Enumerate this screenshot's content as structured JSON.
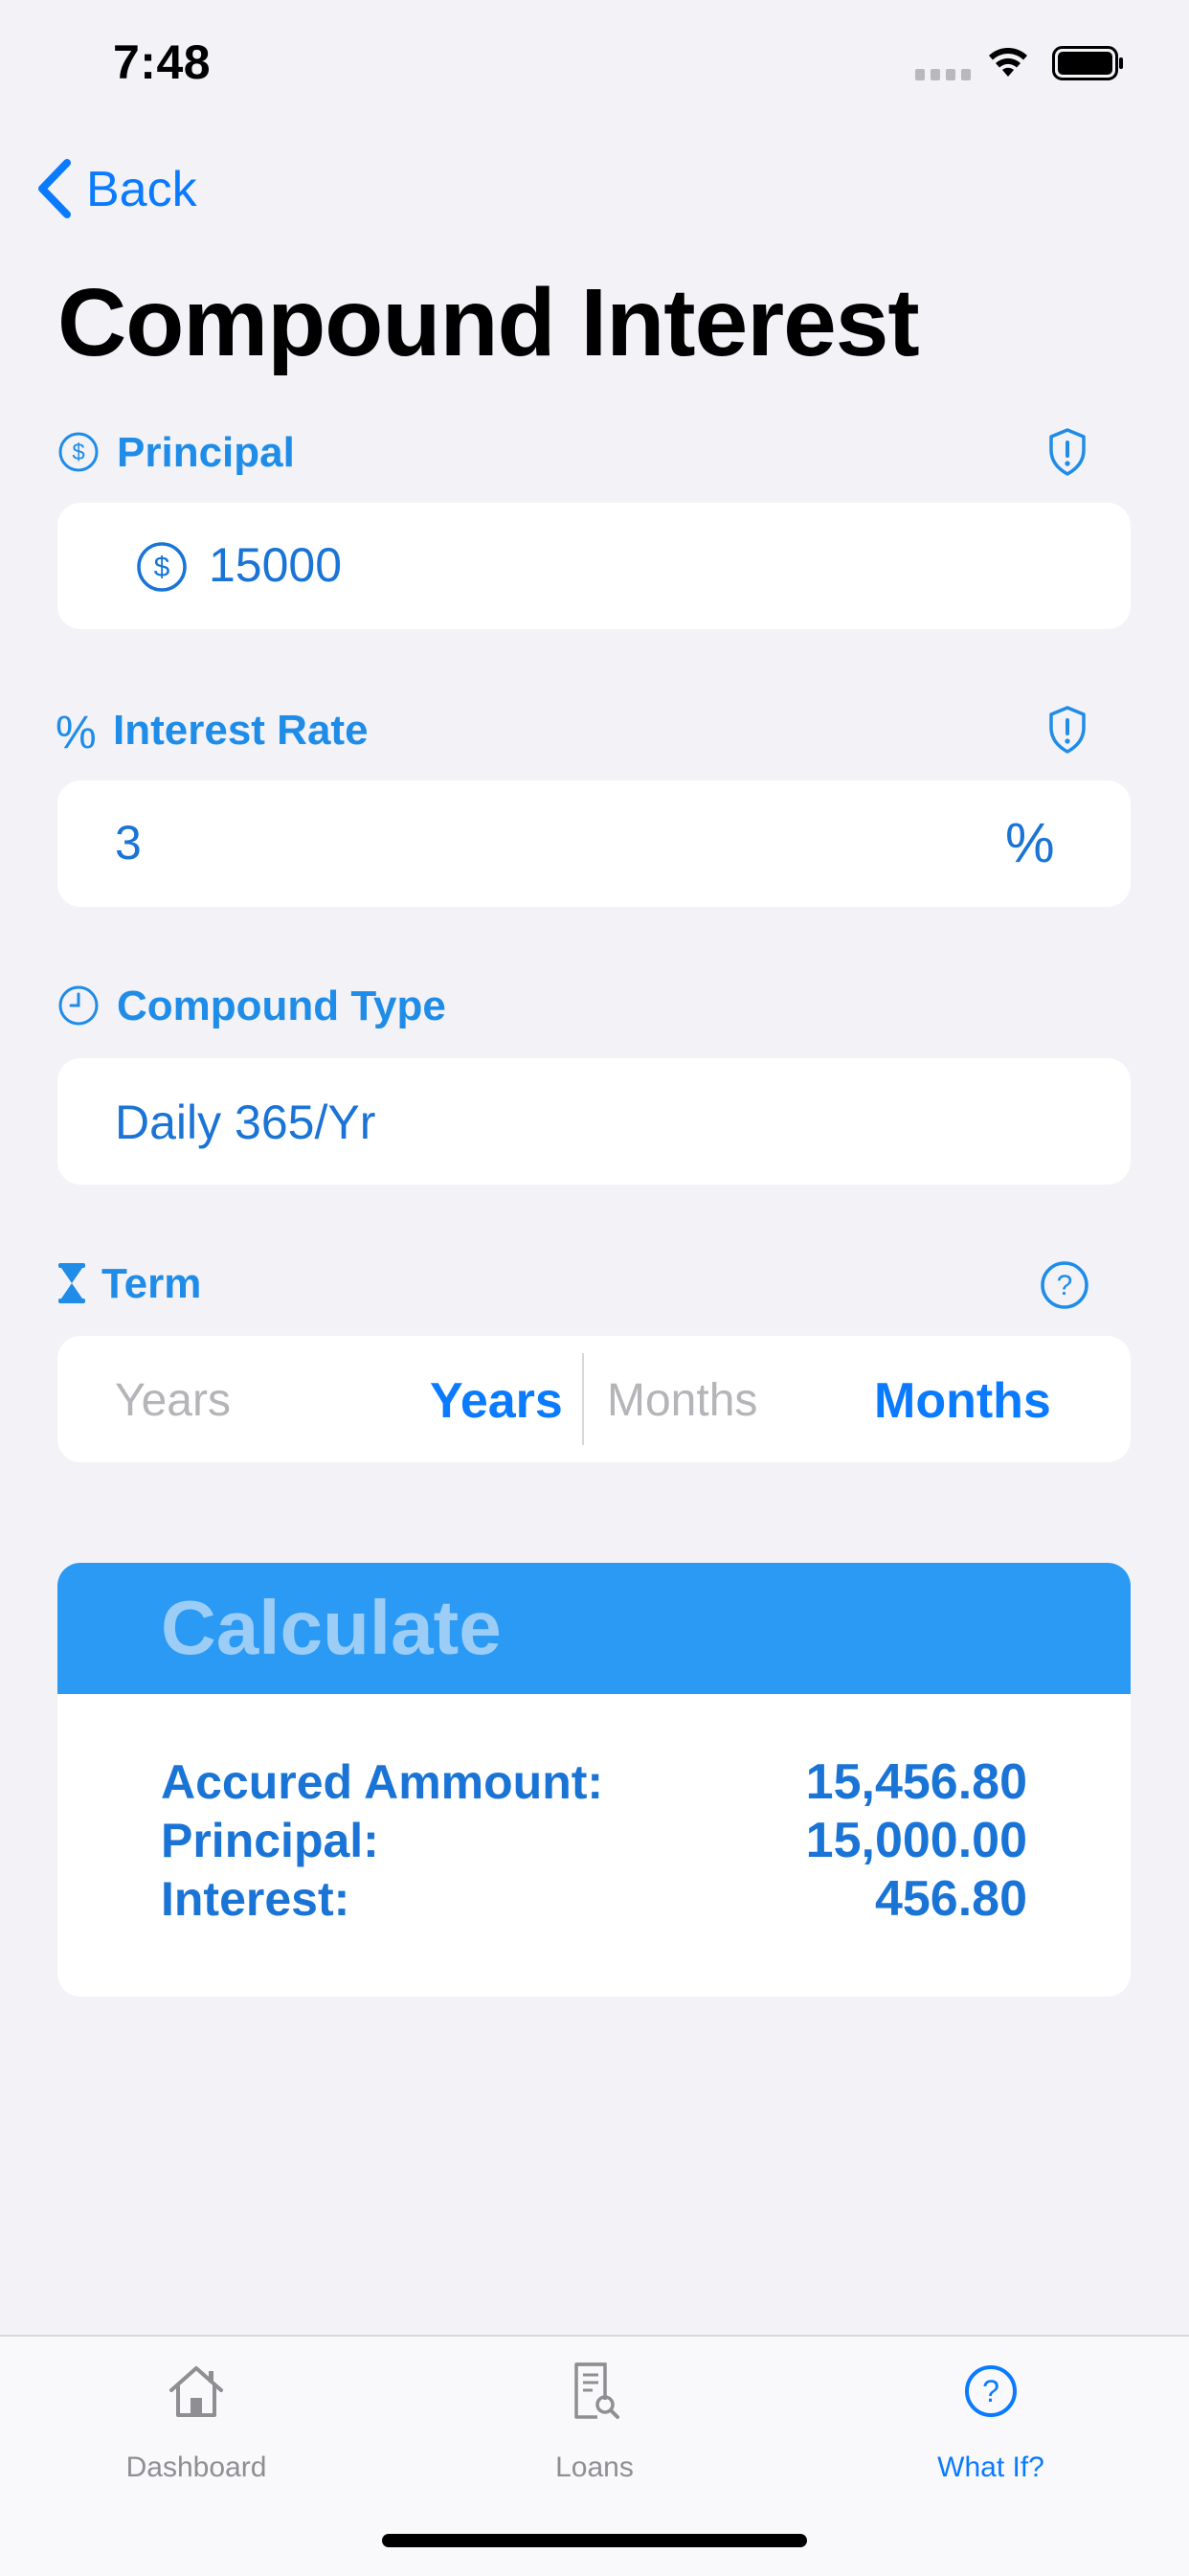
{
  "status_bar": {
    "time": "7:48"
  },
  "nav": {
    "back_label": "Back",
    "title": "Compound Interest"
  },
  "principal": {
    "label": "Principal",
    "value": "15000"
  },
  "interest_rate": {
    "label": "Interest Rate",
    "label_prefix": "%",
    "value": "3",
    "unit": "%"
  },
  "compound_type": {
    "label": "Compound Type",
    "value": "Daily 365/Yr"
  },
  "term": {
    "label": "Term",
    "years_placeholder": "Years",
    "years_label": "Years",
    "months_placeholder": "Months",
    "months_label": "Months"
  },
  "calculate": {
    "label": "Calculate"
  },
  "results": {
    "accrued_label": "Accured Ammount:",
    "accrued_value": "15,456.80",
    "principal_label": "Principal:",
    "principal_value": "15,000.00",
    "interest_label": "Interest:",
    "interest_value": "456.80"
  },
  "tab_bar": {
    "items": [
      {
        "label": "Dashboard",
        "icon": "house-icon",
        "active": false
      },
      {
        "label": "Loans",
        "icon": "document-search-icon",
        "active": false
      },
      {
        "label": "What If?",
        "icon": "question-circle-icon",
        "active": true
      }
    ]
  },
  "colors": {
    "accent": "#0a7aff",
    "label_blue": "#1f8ce8",
    "button_blue": "#2a9af4",
    "background": "#f2f2f7"
  }
}
